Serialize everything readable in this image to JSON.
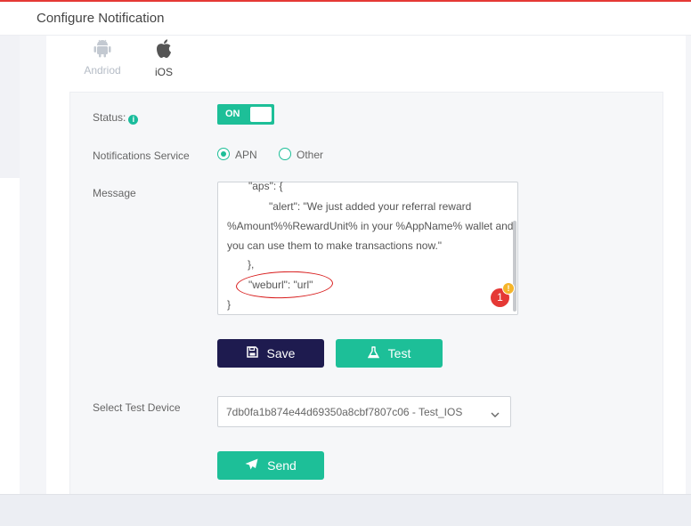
{
  "header": {
    "title": "Configure Notification"
  },
  "platforms": [
    {
      "label": "Andriod",
      "icon": "android-icon",
      "active": false
    },
    {
      "label": "iOS",
      "icon": "apple-icon",
      "active": true
    }
  ],
  "status": {
    "label": "Status:",
    "icon": "info-icon",
    "toggle_label": "ON",
    "value": true
  },
  "notifications_service": {
    "label": "Notifications Service",
    "options": [
      "APN",
      "Other"
    ],
    "selected": "APN"
  },
  "message": {
    "label": "Message",
    "lines": [
      "\"aps\": {",
      "\"alert\": \"We just added your referral reward",
      "%Amount%%RewardUnit% in your %AppName% wallet and",
      "you can use them to make transactions now.\"",
      "},",
      "\"weburl\": \"url\"",
      "}"
    ],
    "error_count": "1",
    "warning_symbol": "!"
  },
  "buttons": {
    "save": "Save",
    "test": "Test",
    "send": "Send"
  },
  "test_device": {
    "label": "Select Test Device",
    "selected": "7db0fa1b874e44d69350a8cbf7807c06 - Test_IOS"
  },
  "colors": {
    "accent": "#1dbf98",
    "primary_dark": "#1e1b4f",
    "error": "#e53935",
    "warning": "#f5b52a"
  }
}
